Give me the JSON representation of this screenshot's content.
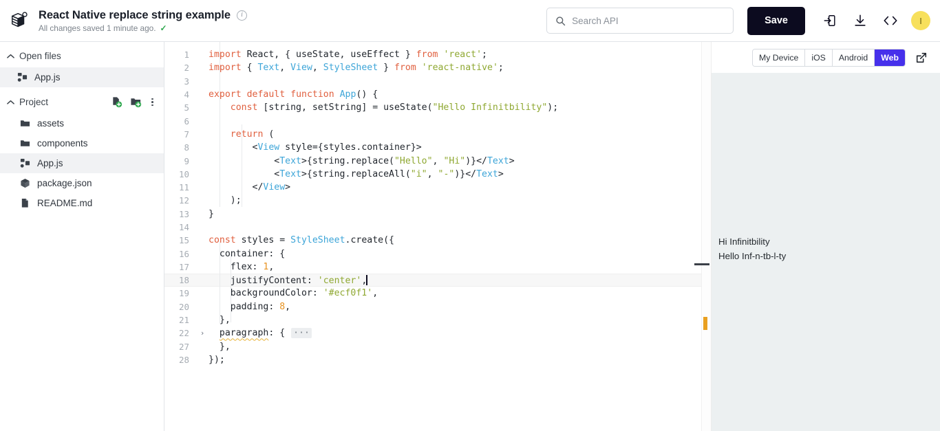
{
  "header": {
    "logo_icon": "snack-cube-logo-icon",
    "title": "React Native replace string example",
    "info_icon": "info-icon",
    "save_status": "All changes saved 1 minute ago.",
    "check_icon": "check-icon",
    "search": {
      "placeholder": "Search API",
      "value": "",
      "icon": "search-icon"
    },
    "save_label": "Save",
    "icons": [
      "import-to-device-icon",
      "download-icon",
      "embed-code-icon"
    ],
    "avatar_initial": "I"
  },
  "sidebar": {
    "open_files": {
      "label": "Open files",
      "chevron_icon": "chevron-up-icon",
      "items": [
        {
          "name": "App.js",
          "icon": "js-file-icon",
          "selected": true
        }
      ]
    },
    "project": {
      "label": "Project",
      "chevron_icon": "chevron-up-icon",
      "actions": [
        "new-file-icon",
        "new-folder-icon",
        "more-options-icon"
      ],
      "items": [
        {
          "name": "assets",
          "icon": "folder-icon",
          "selected": false
        },
        {
          "name": "components",
          "icon": "folder-icon",
          "selected": false
        },
        {
          "name": "App.js",
          "icon": "js-file-icon",
          "selected": true
        },
        {
          "name": "package.json",
          "icon": "package-icon",
          "selected": false
        },
        {
          "name": "README.md",
          "icon": "markdown-file-icon",
          "selected": false
        }
      ]
    }
  },
  "editor": {
    "active_line": 18,
    "lines": [
      {
        "n": "1",
        "tokens": [
          {
            "t": "import",
            "c": "k"
          },
          {
            "t": " React, { useState, useEffect } ",
            "c": "pl"
          },
          {
            "t": "from",
            "c": "k"
          },
          {
            "t": " ",
            "c": "pl"
          },
          {
            "t": "'react'",
            "c": "st"
          },
          {
            "t": ";",
            "c": "pl"
          }
        ]
      },
      {
        "n": "2",
        "tokens": [
          {
            "t": "import",
            "c": "k"
          },
          {
            "t": " { ",
            "c": "pl"
          },
          {
            "t": "Text",
            "c": "ty"
          },
          {
            "t": ", ",
            "c": "pl"
          },
          {
            "t": "View",
            "c": "ty"
          },
          {
            "t": ", ",
            "c": "pl"
          },
          {
            "t": "StyleSheet",
            "c": "ty"
          },
          {
            "t": " } ",
            "c": "pl"
          },
          {
            "t": "from",
            "c": "k"
          },
          {
            "t": " ",
            "c": "pl"
          },
          {
            "t": "'react-native'",
            "c": "st"
          },
          {
            "t": ";",
            "c": "pl"
          }
        ]
      },
      {
        "n": "3",
        "tokens": []
      },
      {
        "n": "4",
        "tokens": [
          {
            "t": "export",
            "c": "k"
          },
          {
            "t": " ",
            "c": "pl"
          },
          {
            "t": "default",
            "c": "k"
          },
          {
            "t": " ",
            "c": "pl"
          },
          {
            "t": "function",
            "c": "k"
          },
          {
            "t": " ",
            "c": "pl"
          },
          {
            "t": "App",
            "c": "ty"
          },
          {
            "t": "() {",
            "c": "pl"
          }
        ]
      },
      {
        "n": "5",
        "tokens": [
          {
            "t": "    ",
            "c": "pl"
          },
          {
            "t": "const",
            "c": "k"
          },
          {
            "t": " [string, setString] = useState(",
            "c": "pl"
          },
          {
            "t": "\"Hello Infinitbility\"",
            "c": "st"
          },
          {
            "t": ");",
            "c": "pl"
          }
        ]
      },
      {
        "n": "6",
        "tokens": []
      },
      {
        "n": "7",
        "tokens": [
          {
            "t": "    ",
            "c": "pl"
          },
          {
            "t": "return",
            "c": "k"
          },
          {
            "t": " (",
            "c": "pl"
          }
        ]
      },
      {
        "n": "8",
        "tokens": [
          {
            "t": "        <",
            "c": "pl"
          },
          {
            "t": "View",
            "c": "ty"
          },
          {
            "t": " style={styles.container}>",
            "c": "pl"
          }
        ]
      },
      {
        "n": "9",
        "tokens": [
          {
            "t": "            <",
            "c": "pl"
          },
          {
            "t": "Text",
            "c": "ty"
          },
          {
            "t": ">{string.replace(",
            "c": "pl"
          },
          {
            "t": "\"Hello\"",
            "c": "st"
          },
          {
            "t": ", ",
            "c": "pl"
          },
          {
            "t": "\"Hi\"",
            "c": "st"
          },
          {
            "t": ")}</",
            "c": "pl"
          },
          {
            "t": "Text",
            "c": "ty"
          },
          {
            "t": ">",
            "c": "pl"
          }
        ]
      },
      {
        "n": "10",
        "tokens": [
          {
            "t": "            <",
            "c": "pl"
          },
          {
            "t": "Text",
            "c": "ty"
          },
          {
            "t": ">{string.replaceAll(",
            "c": "pl"
          },
          {
            "t": "\"i\"",
            "c": "st"
          },
          {
            "t": ", ",
            "c": "pl"
          },
          {
            "t": "\"-\"",
            "c": "st"
          },
          {
            "t": ")}</",
            "c": "pl"
          },
          {
            "t": "Text",
            "c": "ty"
          },
          {
            "t": ">",
            "c": "pl"
          }
        ]
      },
      {
        "n": "11",
        "tokens": [
          {
            "t": "        </",
            "c": "pl"
          },
          {
            "t": "View",
            "c": "ty"
          },
          {
            "t": ">",
            "c": "pl"
          }
        ]
      },
      {
        "n": "12",
        "tokens": [
          {
            "t": "    );",
            "c": "pl"
          }
        ]
      },
      {
        "n": "13",
        "tokens": [
          {
            "t": "}",
            "c": "pl"
          }
        ]
      },
      {
        "n": "14",
        "tokens": []
      },
      {
        "n": "15",
        "tokens": [
          {
            "t": "const",
            "c": "k"
          },
          {
            "t": " styles = ",
            "c": "pl"
          },
          {
            "t": "StyleSheet",
            "c": "ty"
          },
          {
            "t": ".create({",
            "c": "pl"
          }
        ]
      },
      {
        "n": "16",
        "tokens": [
          {
            "t": "  container: {",
            "c": "pl"
          }
        ]
      },
      {
        "n": "17",
        "tokens": [
          {
            "t": "    flex: ",
            "c": "pl"
          },
          {
            "t": "1",
            "c": "nu"
          },
          {
            "t": ",",
            "c": "pl"
          }
        ]
      },
      {
        "n": "18",
        "tokens": [
          {
            "t": "    justifyContent: ",
            "c": "pl"
          },
          {
            "t": "'center'",
            "c": "st"
          },
          {
            "t": ",",
            "c": "pl"
          }
        ],
        "caret": true
      },
      {
        "n": "19",
        "tokens": [
          {
            "t": "    backgroundColor: ",
            "c": "pl"
          },
          {
            "t": "'#ecf0f1'",
            "c": "st"
          },
          {
            "t": ",",
            "c": "pl"
          }
        ]
      },
      {
        "n": "20",
        "tokens": [
          {
            "t": "    padding: ",
            "c": "pl"
          },
          {
            "t": "8",
            "c": "nu"
          },
          {
            "t": ",",
            "c": "pl"
          }
        ]
      },
      {
        "n": "21",
        "tokens": [
          {
            "t": "  },",
            "c": "pl"
          }
        ]
      },
      {
        "n": "22",
        "tokens": [
          {
            "t": "  ",
            "c": "pl"
          },
          {
            "t": "paragraph",
            "c": "squiggle"
          },
          {
            "t": ": { ",
            "c": "pl"
          },
          {
            "t": "···",
            "c": "fold-ellipsis"
          }
        ],
        "fold": "collapsed-chevron-right-icon"
      },
      {
        "n": "27",
        "tokens": [
          {
            "t": "  },",
            "c": "pl"
          }
        ]
      },
      {
        "n": "28",
        "tokens": [
          {
            "t": "});",
            "c": "pl"
          }
        ]
      }
    ]
  },
  "preview": {
    "platforms": [
      {
        "label": "My Device",
        "active": false
      },
      {
        "label": "iOS",
        "active": false
      },
      {
        "label": "Android",
        "active": false
      },
      {
        "label": "Web",
        "active": true
      }
    ],
    "open_external_icon": "open-external-icon",
    "output_lines": [
      "Hi Infinitbility",
      "Hello Inf-n-tb-l-ty"
    ],
    "background": "#ecf0f1"
  },
  "colors": {
    "accent_purple": "#4630eb",
    "save_dark": "#0c0b1f",
    "avatar_yellow": "#f7e05c",
    "keyword": "#e05f3e",
    "type": "#3da5d8",
    "string": "#8fa832",
    "number": "#e8921f"
  }
}
